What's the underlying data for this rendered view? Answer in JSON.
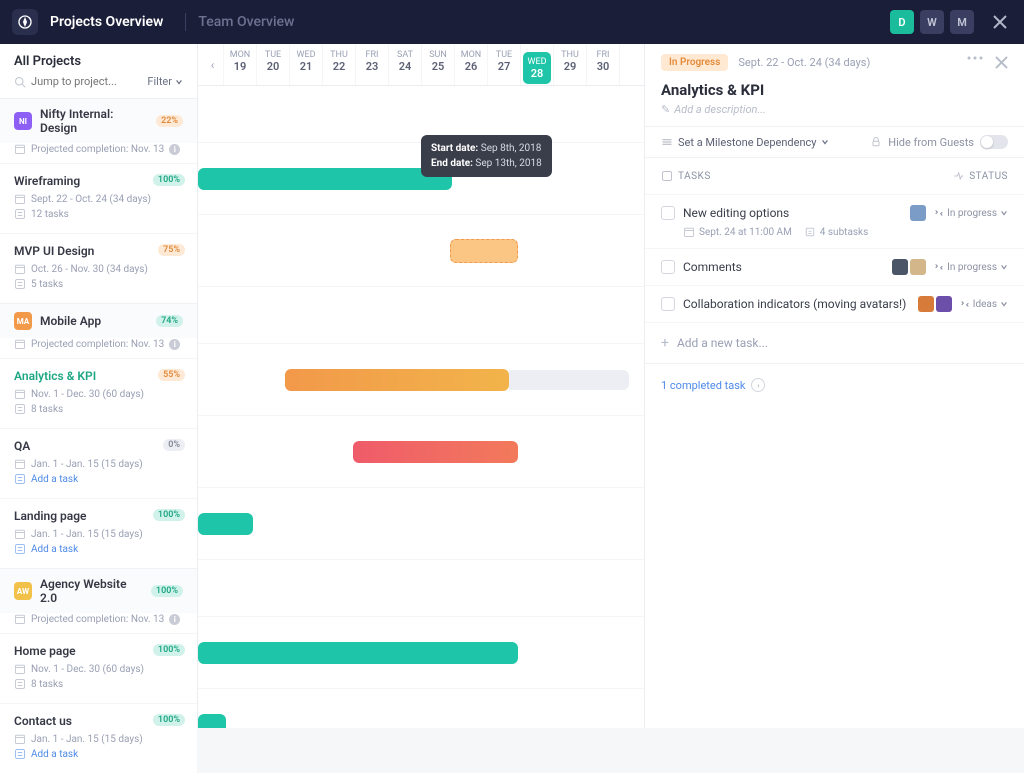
{
  "nav": {
    "active": "Projects Overview",
    "inactive": "Team Overview",
    "avatars": [
      "D",
      "W",
      "M"
    ]
  },
  "sidebar": {
    "title": "All Projects",
    "search_placeholder": "Jump to project...",
    "filter": "Filter"
  },
  "projects": [
    {
      "badge": "NI",
      "badge_color": "purple",
      "name": "Nifty Internal: Design",
      "pct": "22%",
      "pct_style": "orange",
      "sub": "Projected completion: Nov. 13",
      "tasks": [
        {
          "title": "Wireframing",
          "active": false,
          "pct": "100%",
          "pct_style": "teal",
          "dates": "Sept. 22 - Oct. 24 (34 days)",
          "count": "12 tasks",
          "link": false
        },
        {
          "title": "MVP UI Design",
          "active": false,
          "pct": "75%",
          "pct_style": "orange",
          "dates": "Oct. 26 - Nov. 30 (34 days)",
          "count": "5 tasks",
          "link": false
        }
      ]
    },
    {
      "badge": "MA",
      "badge_color": "orange",
      "name": "Mobile App",
      "pct": "74%",
      "pct_style": "teal",
      "sub": "Projected completion: Nov. 13",
      "tasks": [
        {
          "title": "Analytics & KPI",
          "active": true,
          "pct": "55%",
          "pct_style": "orange",
          "dates": "Nov. 1 - Dec. 30 (60 days)",
          "count": "8 tasks",
          "link": false
        },
        {
          "title": "QA",
          "active": false,
          "pct": "0%",
          "pct_style": "grey",
          "dates": "Jan. 1 - Jan. 15 (15 days)",
          "count": "Add a task",
          "link": true
        },
        {
          "title": "Landing page",
          "active": false,
          "pct": "100%",
          "pct_style": "teal",
          "dates": "Jan. 1 - Jan. 15 (15 days)",
          "count": "Add a task",
          "link": true
        }
      ]
    },
    {
      "badge": "AW",
      "badge_color": "gold",
      "name": "Agency Website 2.0",
      "pct": "100%",
      "pct_style": "teal",
      "sub": "Projected completion: Nov. 13",
      "tasks": [
        {
          "title": "Home page",
          "active": false,
          "pct": "100%",
          "pct_style": "teal",
          "dates": "Nov. 1 - Dec. 30 (60 days)",
          "count": "8 tasks",
          "link": false
        },
        {
          "title": "Contact us",
          "active": false,
          "pct": "100%",
          "pct_style": "teal",
          "dates": "Jan. 1 - Jan. 15 (15 days)",
          "count": "Add a task",
          "link": true
        }
      ]
    }
  ],
  "timeline": {
    "days": [
      {
        "d": "MON",
        "n": "19"
      },
      {
        "d": "TUE",
        "n": "20"
      },
      {
        "d": "WED",
        "n": "21"
      },
      {
        "d": "THU",
        "n": "22"
      },
      {
        "d": "FRI",
        "n": "23"
      },
      {
        "d": "SAT",
        "n": "24"
      },
      {
        "d": "SUN",
        "n": "25"
      },
      {
        "d": "MON",
        "n": "26"
      },
      {
        "d": "TUE",
        "n": "27"
      },
      {
        "d": "WED",
        "n": "28",
        "today": true
      },
      {
        "d": "THU",
        "n": "29"
      },
      {
        "d": "FRI",
        "n": "30"
      }
    ],
    "tooltip": {
      "start_label": "Start date:",
      "start_val": "Sep 8th, 2018",
      "end_label": "End date:",
      "end_val": "Sep 13th, 2018"
    }
  },
  "detail": {
    "status": "In Progress",
    "dates": "Sept. 22 - Oct. 24 (34 days)",
    "title": "Analytics & KPI",
    "desc_placeholder": "Add a description...",
    "milestone": "Set a Milestone Dependency",
    "hide_guests": "Hide from Guests",
    "tasks_label": "TASKS",
    "status_label": "STATUS",
    "tasks": [
      {
        "title": "New editing options",
        "status": "In progress",
        "date": "Sept. 24 at 11:00 AM",
        "sub": "4 subtasks"
      },
      {
        "title": "Comments",
        "status": "In progress"
      },
      {
        "title": "Collaboration indicators (moving avatars!)",
        "status": "Ideas"
      }
    ],
    "add_task": "Add a new task...",
    "completed": "1 completed task"
  }
}
